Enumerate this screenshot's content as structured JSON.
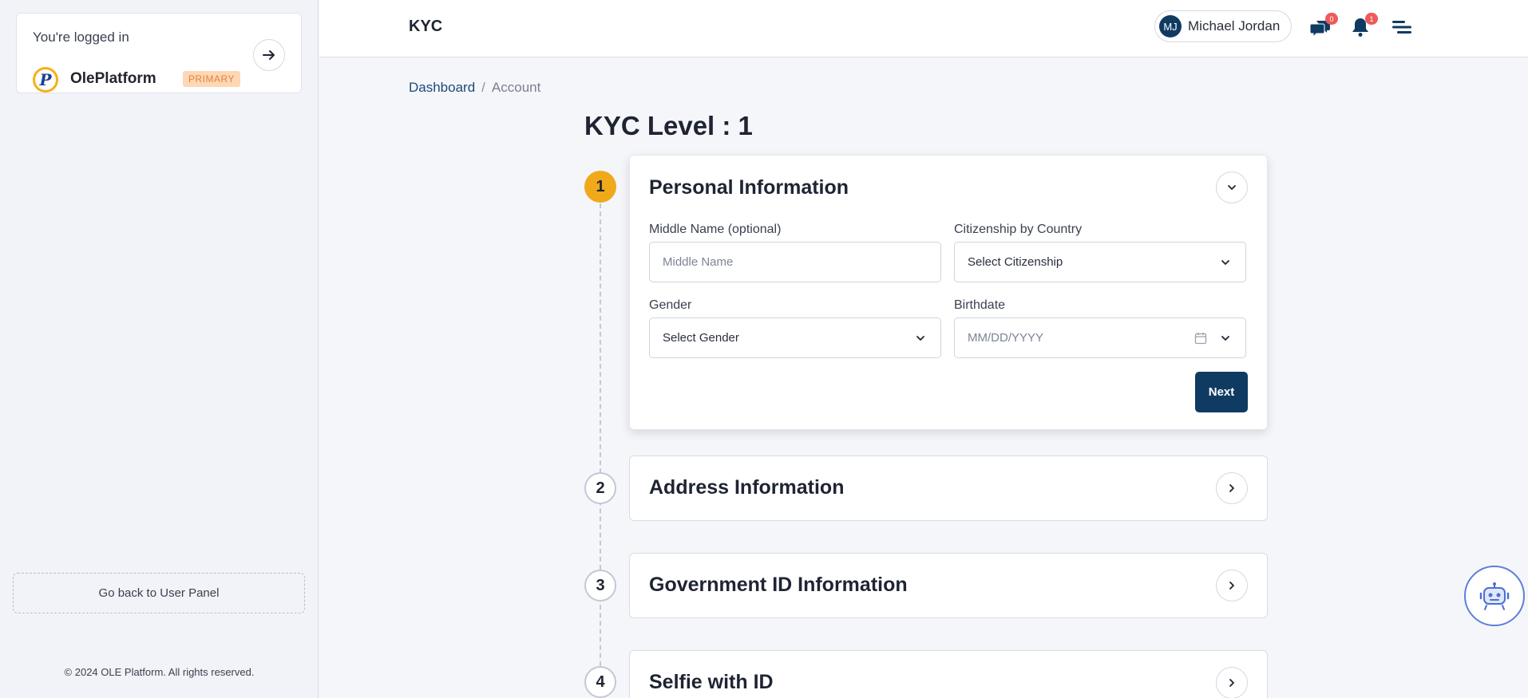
{
  "sidebar": {
    "logged_in_text": "You're logged in",
    "platform_name": "OlePlatform",
    "platform_badge": "PRIMARY",
    "logo_letter": "P",
    "back_button": "Go back to User Panel",
    "copyright": "© 2024 OLE Platform. All rights reserved."
  },
  "header": {
    "title": "KYC",
    "user_initials": "MJ",
    "user_name": "Michael Jordan",
    "messages_count": "0",
    "notifications_count": "1"
  },
  "breadcrumb": {
    "items": [
      "Dashboard",
      "Account"
    ],
    "separator": "/"
  },
  "page": {
    "title": "KYC Level : 1"
  },
  "steps": [
    {
      "number": "1",
      "title": "Personal Information",
      "expanded": true
    },
    {
      "number": "2",
      "title": "Address Information",
      "expanded": false
    },
    {
      "number": "3",
      "title": "Government ID Information",
      "expanded": false
    },
    {
      "number": "4",
      "title": "Selfie with ID",
      "expanded": false
    }
  ],
  "personal_form": {
    "middle_name_label": "Middle Name (optional)",
    "middle_name_placeholder": "Middle Name",
    "citizenship_label": "Citizenship by Country",
    "citizenship_value": "Select Citizenship",
    "gender_label": "Gender",
    "gender_value": "Select Gender",
    "birthdate_label": "Birthdate",
    "birthdate_placeholder": "MM/DD/YYYY",
    "next_label": "Next"
  },
  "colors": {
    "primary": "#0f3b63",
    "active_step": "#efa91a",
    "badge_red": "#ef5a5a",
    "bot_blue": "#5d7fd8"
  }
}
